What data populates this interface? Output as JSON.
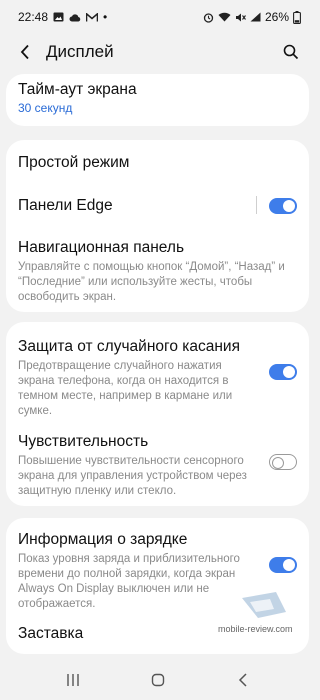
{
  "status": {
    "time": "22:48",
    "battery": "26%",
    "dot": "•",
    "left_icons": [
      "image-icon",
      "cloud-icon",
      "m-icon"
    ],
    "right_icons": [
      "alarm-icon",
      "wifi-icon",
      "mute-icon",
      "signal-icon",
      "battery-icon"
    ]
  },
  "header": {
    "title": "Дисплей"
  },
  "items": {
    "timeout": {
      "title": "Тайм-аут экрана",
      "value": "30 секунд"
    },
    "easy_mode": {
      "title": "Простой режим"
    },
    "edge_panels": {
      "title": "Панели Edge",
      "enabled": true
    },
    "nav_bar": {
      "title": "Навигационная панель",
      "subtitle": "Управляйте с помощью кнопок “Домой”, “Назад” и “Последние” или используйте жесты, чтобы освободить экран."
    },
    "accidental_touch": {
      "title": "Защита от случайного касания",
      "subtitle": "Предотвращение случайного нажатия экрана телефона, когда он находится в темном месте, например в кармане или сумке.",
      "enabled": true
    },
    "sensitivity": {
      "title": "Чувствительность",
      "subtitle": "Повышение чувствительности сенсорного экрана для управления устройством через защитную пленку или стекло.",
      "enabled": false
    },
    "charging_info": {
      "title": "Информация о зарядке",
      "subtitle": "Показ уровня заряда и приблизительного времени до полной зарядки, когда экран Always On Display выключен или не отображается.",
      "enabled": true
    },
    "screensaver": {
      "title": "Заставка"
    }
  },
  "watermark": {
    "text": "mobile-review.com"
  },
  "colors": {
    "accent": "#3e7dea",
    "value_blue": "#2a6bd6",
    "background": "#f2f2f2"
  }
}
